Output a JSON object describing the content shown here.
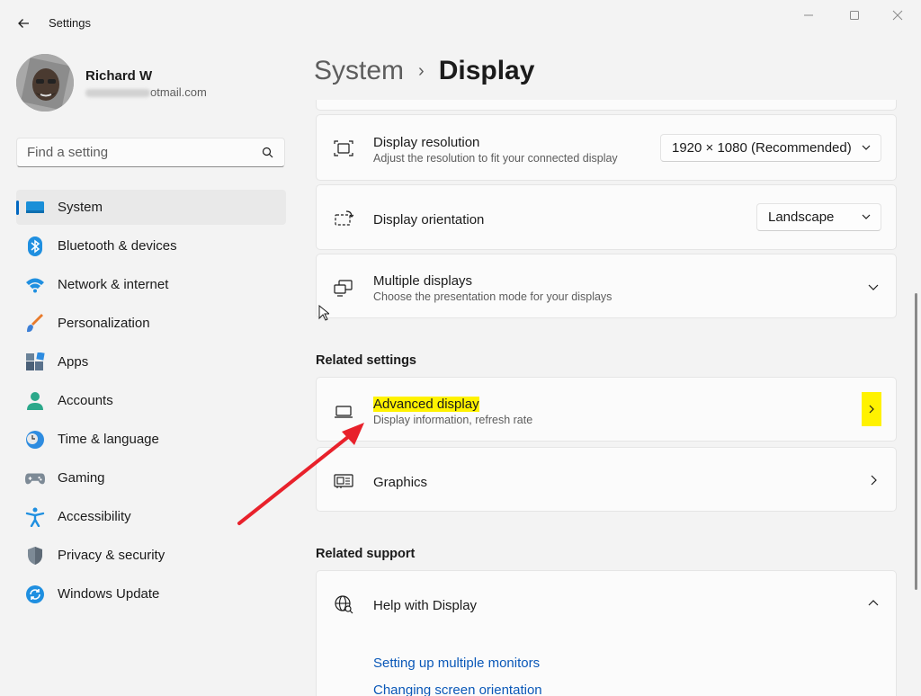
{
  "app": {
    "title": "Settings"
  },
  "window_controls": [
    "minimize",
    "maximize",
    "close"
  ],
  "profile": {
    "name": "Richard W",
    "email_visible": "otmail.com"
  },
  "search": {
    "placeholder": "Find a setting",
    "value": ""
  },
  "sidebar": {
    "items": [
      {
        "label": "System",
        "icon": "system-icon",
        "active": true
      },
      {
        "label": "Bluetooth & devices",
        "icon": "bluetooth-icon",
        "active": false
      },
      {
        "label": "Network & internet",
        "icon": "wifi-icon",
        "active": false
      },
      {
        "label": "Personalization",
        "icon": "brush-icon",
        "active": false
      },
      {
        "label": "Apps",
        "icon": "apps-icon",
        "active": false
      },
      {
        "label": "Accounts",
        "icon": "accounts-icon",
        "active": false
      },
      {
        "label": "Time & language",
        "icon": "clock-globe-icon",
        "active": false
      },
      {
        "label": "Gaming",
        "icon": "gamepad-icon",
        "active": false
      },
      {
        "label": "Accessibility",
        "icon": "accessibility-icon",
        "active": false
      },
      {
        "label": "Privacy & security",
        "icon": "shield-icon",
        "active": false
      },
      {
        "label": "Windows Update",
        "icon": "update-icon",
        "active": false
      }
    ]
  },
  "breadcrumb": {
    "parent": "System",
    "separator": "›",
    "current": "Display"
  },
  "settings": {
    "resolution": {
      "title": "Display resolution",
      "subtitle": "Adjust the resolution to fit your connected display",
      "value": "1920 × 1080 (Recommended)"
    },
    "orientation": {
      "title": "Display orientation",
      "value": "Landscape"
    },
    "multiple": {
      "title": "Multiple displays",
      "subtitle": "Choose the presentation mode for your displays"
    }
  },
  "related_settings": {
    "heading": "Related settings",
    "advanced": {
      "title": "Advanced display",
      "subtitle": "Display information, refresh rate"
    },
    "graphics": {
      "title": "Graphics"
    }
  },
  "related_support": {
    "heading": "Related support",
    "help": {
      "title": "Help with Display"
    },
    "links": [
      "Setting up multiple monitors",
      "Changing screen orientation"
    ]
  },
  "colors": {
    "accent": "#0067c0",
    "highlight": "#fff200",
    "annotation_arrow": "#e8212b",
    "link": "#0a58b8"
  }
}
